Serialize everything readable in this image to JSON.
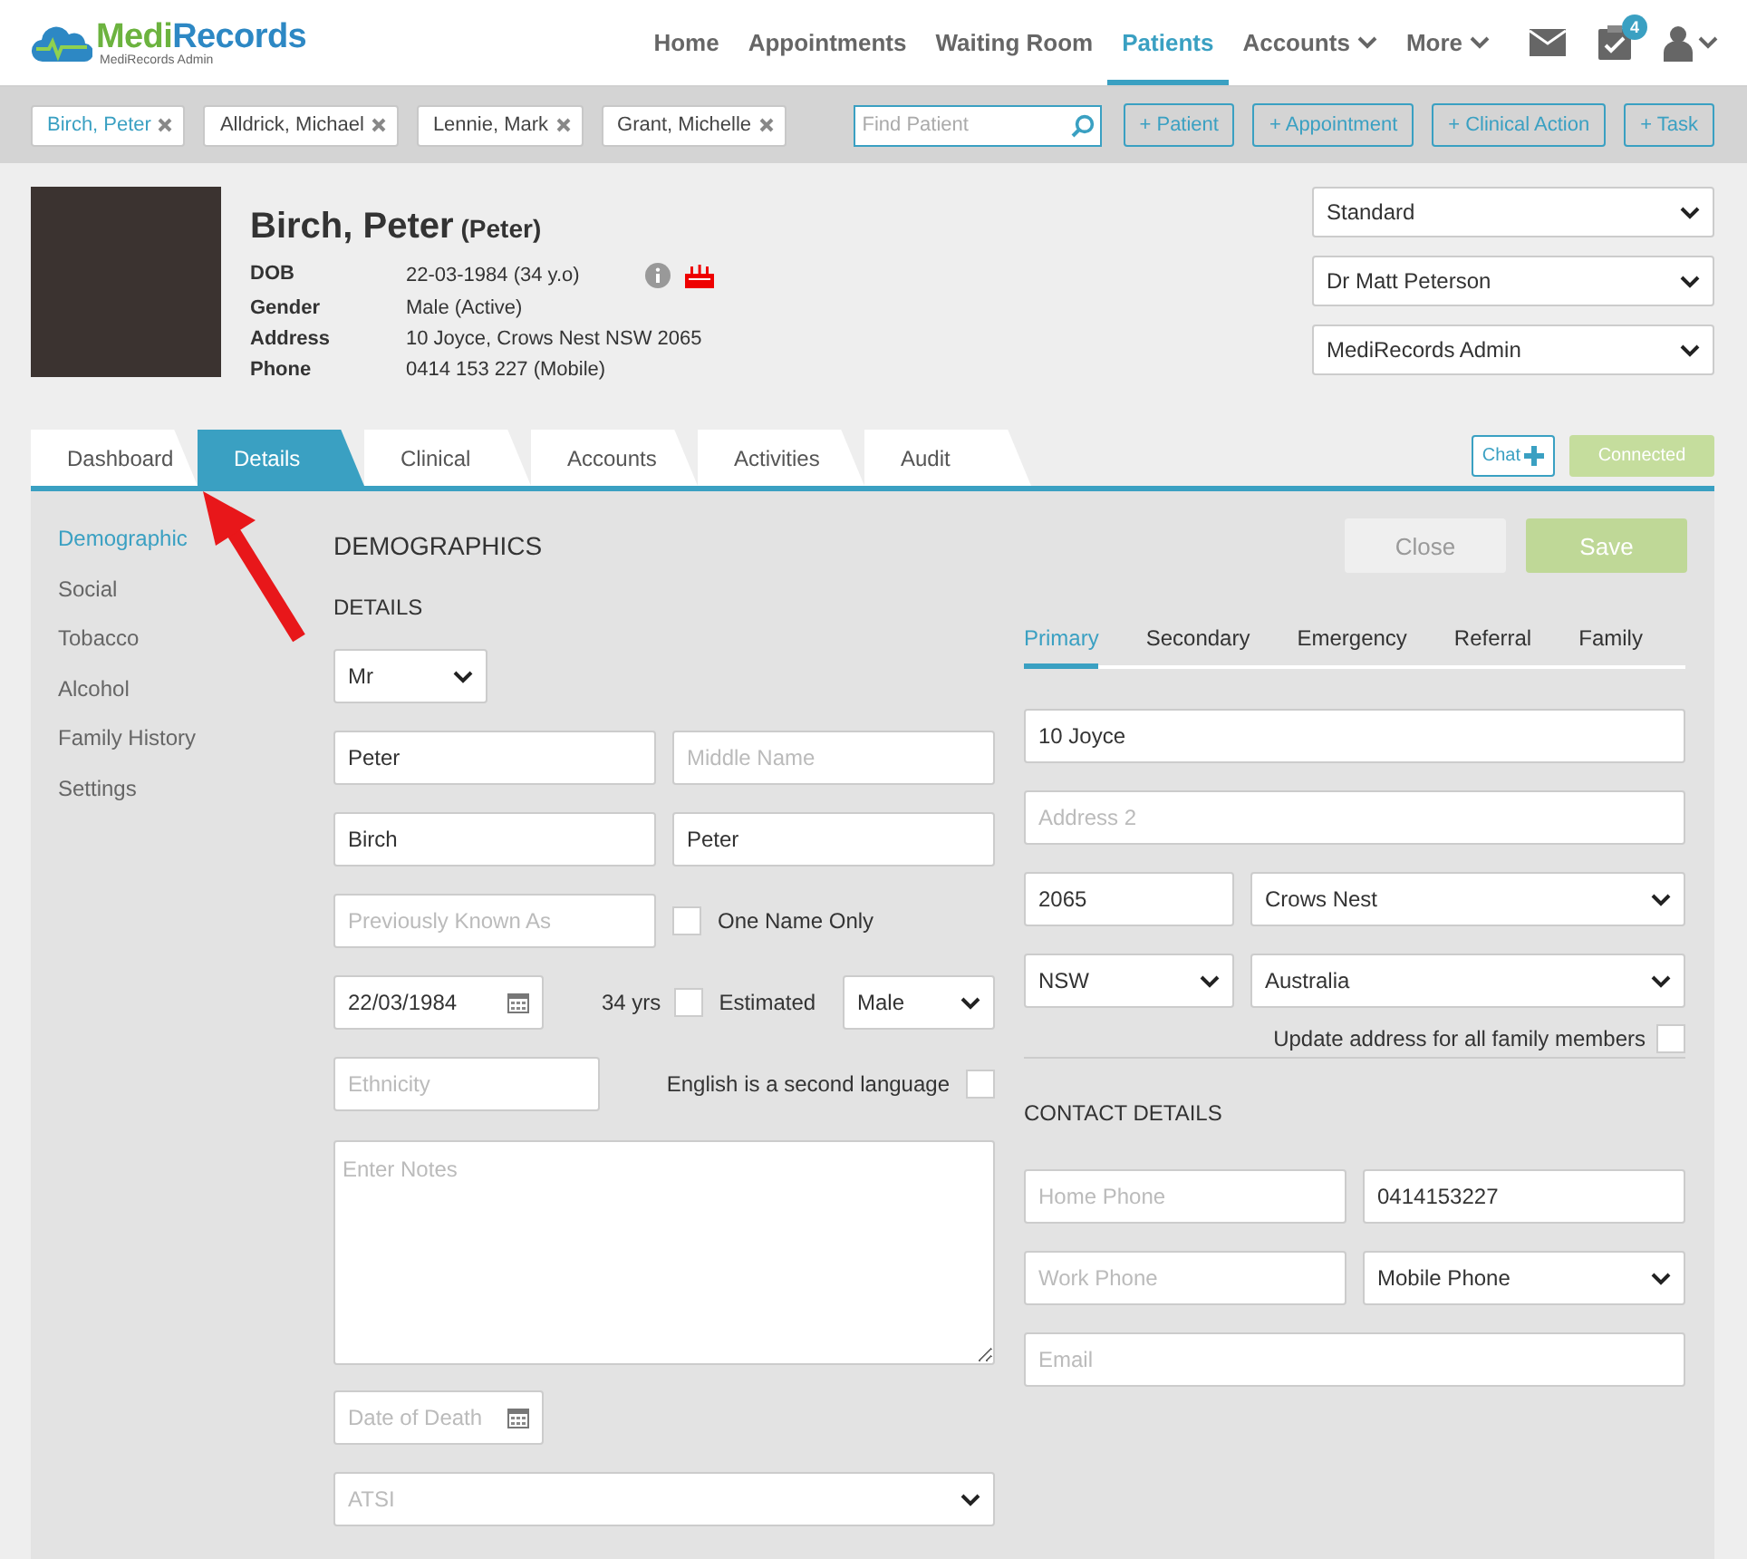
{
  "logo": {
    "first": "Medi",
    "second": "Records",
    "subtitle": "MediRecords Admin"
  },
  "nav": [
    {
      "label": "Home",
      "selected": false,
      "dropdown": false
    },
    {
      "label": "Appointments",
      "selected": false,
      "dropdown": false
    },
    {
      "label": "Waiting Room",
      "selected": false,
      "dropdown": false
    },
    {
      "label": "Patients",
      "selected": true,
      "dropdown": false
    },
    {
      "label": "Accounts",
      "selected": false,
      "dropdown": true
    },
    {
      "label": "More",
      "selected": false,
      "dropdown": true
    }
  ],
  "tasks_badge": "4",
  "open_patients": [
    {
      "label": "Birch, Peter",
      "selected": true
    },
    {
      "label": "Alldrick, Michael",
      "selected": false
    },
    {
      "label": "Lennie, Mark",
      "selected": false
    },
    {
      "label": "Grant, Michelle",
      "selected": false
    }
  ],
  "find_patient": {
    "placeholder": "Find Patient"
  },
  "actions": [
    "+ Patient",
    "+ Appointment",
    "+ Clinical Action",
    "+ Task"
  ],
  "patient": {
    "name": "Birch, Peter",
    "preferred": "(Peter)",
    "fields": [
      {
        "label": "DOB",
        "value": "22-03-1984 (34 y.o)"
      },
      {
        "label": "Gender",
        "value": "Male (Active)"
      },
      {
        "label": "Address",
        "value": "10 Joyce, Crows Nest NSW 2065"
      },
      {
        "label": "Phone",
        "value": "0414 153 227 (Mobile)"
      }
    ]
  },
  "header_selects": [
    "Standard",
    "Dr Matt Peterson",
    "MediRecords Admin"
  ],
  "tabs": [
    {
      "label": "Dashboard",
      "selected": false
    },
    {
      "label": "Details",
      "selected": true
    },
    {
      "label": "Clinical",
      "selected": false
    },
    {
      "label": "Accounts",
      "selected": false
    },
    {
      "label": "Activities",
      "selected": false
    },
    {
      "label": "Audit",
      "selected": false
    }
  ],
  "chat": "Chat",
  "connection": "Connected",
  "sidebar": [
    {
      "label": "Demographic",
      "selected": true
    },
    {
      "label": "Social",
      "selected": false
    },
    {
      "label": "Tobacco",
      "selected": false
    },
    {
      "label": "Alcohol",
      "selected": false
    },
    {
      "label": "Family History",
      "selected": false
    },
    {
      "label": "Settings",
      "selected": false
    }
  ],
  "section_title": "DEMOGRAPHICS",
  "close_button": "Close",
  "save_button": "Save",
  "details": {
    "title": "DETAILS",
    "title_select": "Mr",
    "first_name": "Peter",
    "middle_name_placeholder": "Middle Name",
    "last_name": "Birch",
    "preferred_name": "Peter",
    "previous_name_placeholder": "Previously Known As",
    "one_name_only": {
      "label": "One Name Only",
      "checked": false
    },
    "dob": "22/03/1984",
    "age": "34 yrs",
    "estimated": {
      "label": "Estimated",
      "checked": false
    },
    "gender": "Male",
    "ethnicity_placeholder": "Ethnicity",
    "second_language": {
      "label": "English is a second language",
      "checked": false
    },
    "notes_placeholder": "Enter Notes",
    "date_of_death_placeholder": "Date of Death",
    "atsi_placeholder": "ATSI"
  },
  "address_tabs": [
    {
      "label": "Primary",
      "selected": true
    },
    {
      "label": "Secondary",
      "selected": false
    },
    {
      "label": "Emergency",
      "selected": false
    },
    {
      "label": "Referral",
      "selected": false
    },
    {
      "label": "Family",
      "selected": false
    }
  ],
  "address": {
    "line1": "10 Joyce",
    "line2_placeholder": "Address 2",
    "postcode": "2065",
    "suburb": "Crows Nest",
    "state": "NSW",
    "country": "Australia",
    "update_family": {
      "label": "Update address for all family members",
      "checked": false
    }
  },
  "contact": {
    "title": "CONTACT DETAILS",
    "home_phone_placeholder": "Home Phone",
    "mobile": "0414153227",
    "work_phone_placeholder": "Work Phone",
    "phone_type": "Mobile Phone",
    "email_placeholder": "Email"
  }
}
